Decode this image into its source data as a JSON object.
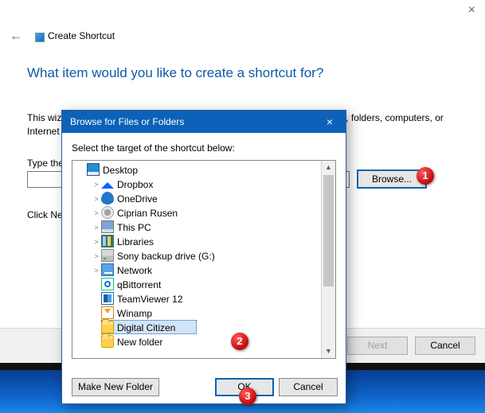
{
  "wizard": {
    "title": "Create Shortcut",
    "heading": "What item would you like to create a shortcut for?",
    "description": "This wizard helps you to create shortcuts to local or network programs, files, folders, computers, or Internet addresses.",
    "type_label": "Type the location of the item:",
    "location_value": "",
    "browse_label": "Browse...",
    "click_next": "Click Next to continue.",
    "next_label": "Next",
    "cancel_label": "Cancel"
  },
  "modal": {
    "title": "Browse for Files or Folders",
    "instruction": "Select the target of the shortcut below:",
    "make_folder_label": "Make New Folder",
    "ok_label": "OK",
    "cancel_label": "Cancel"
  },
  "tree": {
    "items": [
      {
        "indent": 0,
        "twisty": "",
        "icon": "desktop",
        "label": "Desktop"
      },
      {
        "indent": 1,
        "twisty": ">",
        "icon": "dropbox",
        "label": "Dropbox"
      },
      {
        "indent": 1,
        "twisty": ">",
        "icon": "onedrive",
        "label": "OneDrive"
      },
      {
        "indent": 1,
        "twisty": ">",
        "icon": "user",
        "label": "Ciprian Rusen"
      },
      {
        "indent": 1,
        "twisty": ">",
        "icon": "thispc",
        "label": "This PC"
      },
      {
        "indent": 1,
        "twisty": ">",
        "icon": "libs",
        "label": "Libraries"
      },
      {
        "indent": 1,
        "twisty": ">",
        "icon": "drive",
        "label": "Sony backup drive (G:)"
      },
      {
        "indent": 1,
        "twisty": ">",
        "icon": "network",
        "label": "Network"
      },
      {
        "indent": 1,
        "twisty": "",
        "icon": "qb",
        "label": "qBittorrent"
      },
      {
        "indent": 1,
        "twisty": "",
        "icon": "tv",
        "label": "TeamViewer 12"
      },
      {
        "indent": 1,
        "twisty": "",
        "icon": "winamp",
        "label": "Winamp"
      },
      {
        "indent": 1,
        "twisty": "",
        "icon": "folder",
        "label": "Digital Citizen",
        "selected": true
      },
      {
        "indent": 1,
        "twisty": "",
        "icon": "folder",
        "label": "New folder"
      }
    ]
  },
  "callouts": {
    "c1": "1",
    "c2": "2",
    "c3": "3"
  }
}
